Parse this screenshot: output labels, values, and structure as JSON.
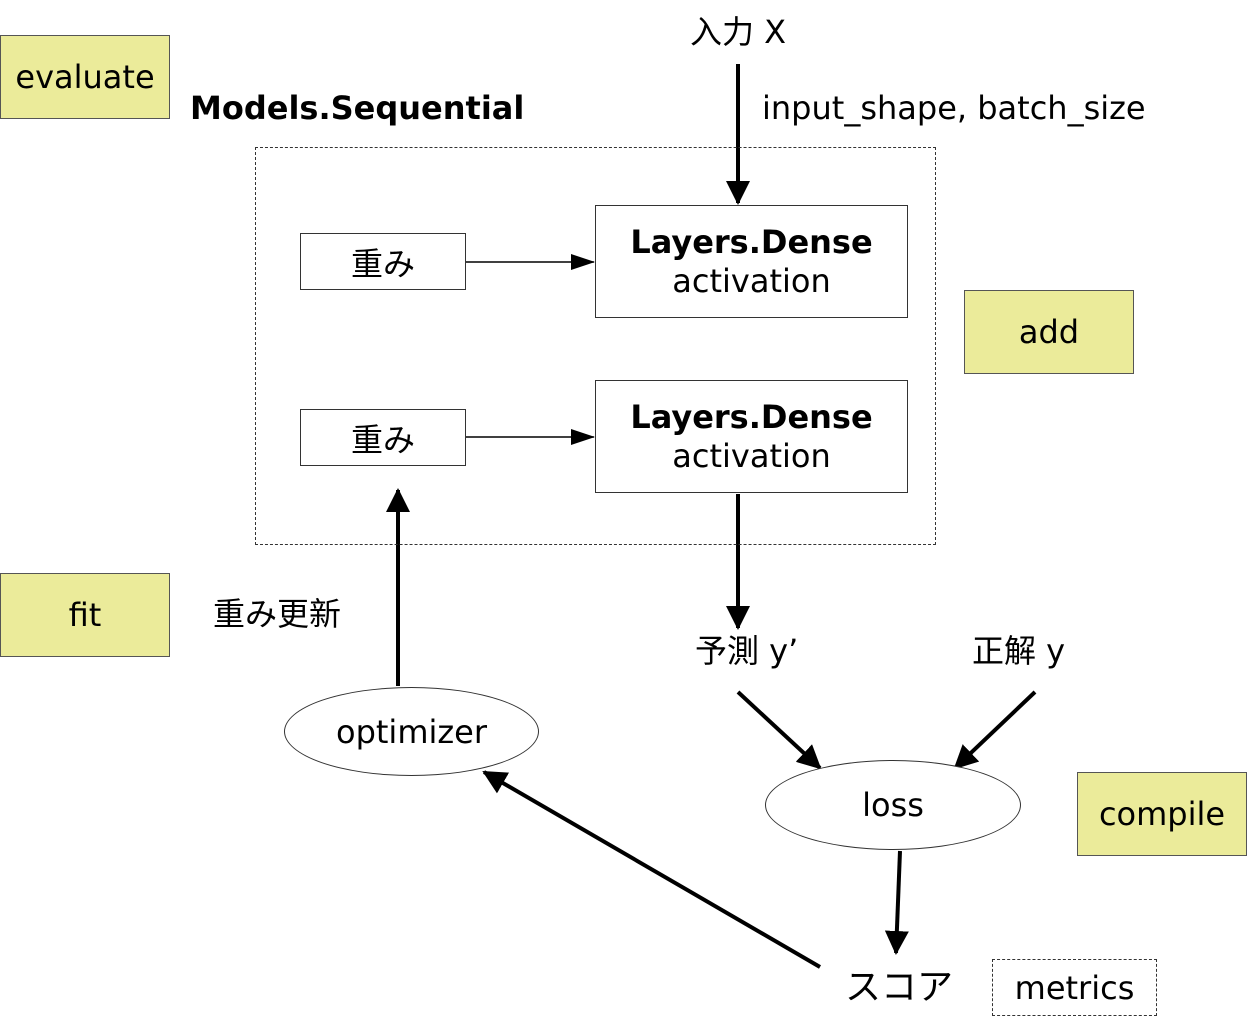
{
  "side_labels": {
    "evaluate": "evaluate",
    "add": "add",
    "fit": "fit",
    "compile": "compile"
  },
  "model": {
    "title": "Models.Sequential",
    "layers": [
      {
        "title": "Layers.Dense",
        "subtitle": "activation",
        "weight": "重み"
      },
      {
        "title": "Layers.Dense",
        "subtitle": "activation",
        "weight": "重み"
      }
    ]
  },
  "input": {
    "label": "入力  X",
    "params": "input_shape, batch_size"
  },
  "prediction_label": "予測  y’",
  "truth_label": "正解  y",
  "loss_label": "loss",
  "optimizer_label": "optimizer",
  "weight_update_label": "重み更新",
  "score_label": "スコア",
  "metrics_label": "metrics"
}
